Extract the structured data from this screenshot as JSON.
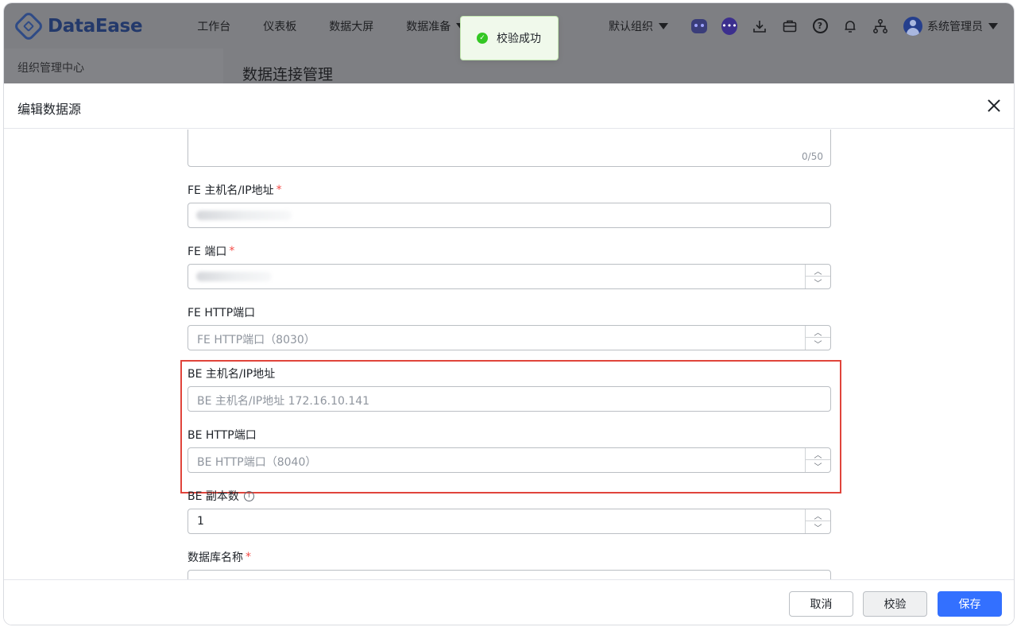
{
  "app": {
    "brand": "DataEase"
  },
  "nav": {
    "items": [
      "工作台",
      "仪表板",
      "数据大屏"
    ],
    "dropdown_item": "数据准备"
  },
  "top_right": {
    "org": "默认组织",
    "user": "系统管理员",
    "icons": [
      "robot-icon",
      "chat-icon",
      "download-icon",
      "briefcase-icon",
      "help-icon",
      "bell-icon",
      "org-tree-icon"
    ]
  },
  "subbar": {
    "left": "组织管理中心",
    "title": "数据连接管理"
  },
  "toast": {
    "message": "校验成功",
    "color": "#34c724"
  },
  "drawer": {
    "title": "编辑数据源",
    "textarea_count": "0/50",
    "fields": {
      "fe_host": {
        "label": "FE 主机名/IP地址",
        "required": true
      },
      "fe_port": {
        "label": "FE 端口",
        "required": true
      },
      "fe_http_port": {
        "label": "FE HTTP端口",
        "placeholder": "FE HTTP端口（8030）"
      },
      "be_host": {
        "label": "BE 主机名/IP地址",
        "placeholder": "BE 主机名/IP地址 172.16.10.141"
      },
      "be_http_port": {
        "label": "BE HTTP端口",
        "placeholder": "BE HTTP端口（8040）"
      },
      "be_replicas": {
        "label": "BE 副本数",
        "value": "1"
      },
      "db_name": {
        "label": "数据库名称",
        "required": true
      }
    },
    "required_mark": "*",
    "highlight_color": "#e0443b"
  },
  "footer": {
    "cancel": "取消",
    "check": "校验",
    "save": "保存",
    "primary_color": "#3370ff"
  }
}
